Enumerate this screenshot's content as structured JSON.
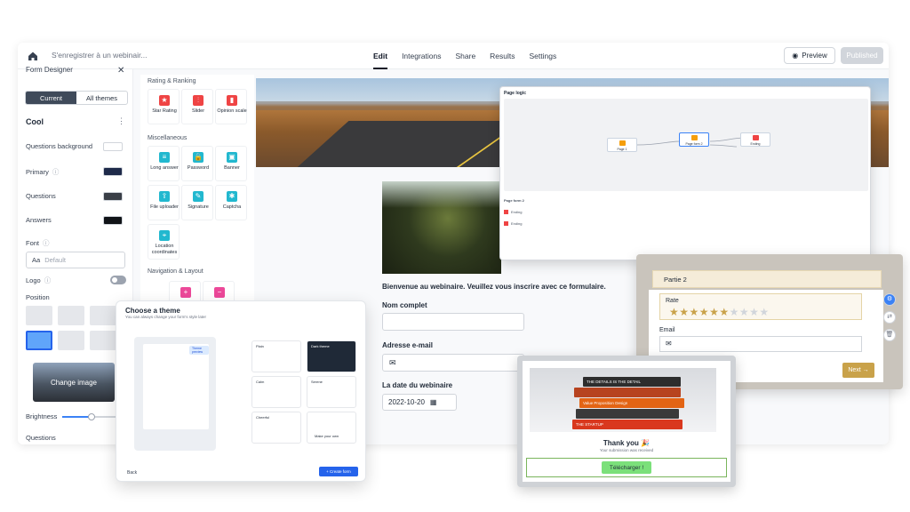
{
  "topbar": {
    "breadcrumb": "S'enregistrer à un webinair...",
    "tabs": [
      "Edit",
      "Integrations",
      "Share",
      "Results",
      "Settings"
    ],
    "active_tab": "Edit",
    "preview_label": "Preview",
    "publish_label": "Published"
  },
  "left_panel": {
    "title": "Form Designer",
    "seg_current": "Current",
    "seg_all": "All themes",
    "theme_name": "Cool",
    "rows": {
      "questions_bg": "Questions background",
      "primary": "Primary",
      "questions": "Questions",
      "answers": "Answers",
      "font": "Font",
      "font_value": "Default",
      "logo": "Logo",
      "position": "Position",
      "change_image": "Change image",
      "brightness": "Brightness",
      "questions_footer": "Questions"
    },
    "colors": {
      "questions_bg": "#ffffff",
      "primary": "#1e2a4a",
      "questions": "#3a3f47",
      "answers": "#111418"
    },
    "brightness_value": 0.55
  },
  "palette": {
    "sections": [
      "Rating & Ranking",
      "Miscellaneous",
      "Navigation & Layout"
    ],
    "items": [
      {
        "label": "Star Rating",
        "color": "#ef4444",
        "icon": "★"
      },
      {
        "label": "Slider",
        "color": "#ef4444",
        "icon": "⫶"
      },
      {
        "label": "Opinion scale",
        "color": "#ef4444",
        "icon": "▮"
      },
      {
        "label": "Long answer",
        "color": "#22b8cf",
        "icon": "≡"
      },
      {
        "label": "Password",
        "color": "#22b8cf",
        "icon": "🔒"
      },
      {
        "label": "Banner",
        "color": "#22b8cf",
        "icon": "▣"
      },
      {
        "label": "File uploader",
        "color": "#22b8cf",
        "icon": "⇪"
      },
      {
        "label": "Signature",
        "color": "#22b8cf",
        "icon": "✎"
      },
      {
        "label": "Captcha",
        "color": "#22b8cf",
        "icon": "✱"
      },
      {
        "label": "Location coordinates",
        "color": "#22b8cf",
        "icon": "⌖"
      }
    ]
  },
  "form": {
    "intro": "Bienvenue au webinaire. Veuillez vous inscrire avec ce formulaire.",
    "name_label": "Nom complet",
    "email_label": "Adresse e-mail",
    "date_label": "La date du webinaire",
    "date_value": "2022-10-20"
  },
  "logic": {
    "title": "Page logic",
    "nodes": [
      "Page 1",
      "Page form 2",
      "Ending"
    ],
    "section": "Page form 2",
    "rows": [
      "Ending",
      "Ending"
    ]
  },
  "choose_theme": {
    "title": "Choose a theme",
    "subtitle": "You can always change your form's style later",
    "preview_badge": "Theme preview",
    "themes": [
      "Plain",
      "Dark theme",
      "Calm",
      "Serene",
      "Cheerful",
      "Make your own"
    ],
    "back": "Back",
    "create": "+ Create form"
  },
  "partie": {
    "title": "Partie 2",
    "rate_label": "Rate",
    "rating": 6,
    "rating_max": 10,
    "email_label": "Email",
    "next_label": "Next →"
  },
  "thanks": {
    "title": "Thank you 🎉",
    "subtitle": "Your submission was received",
    "button": "Télécharger !",
    "books": [
      "THE DETAILS IS THE DETAIL",
      "Value Proposition Design",
      "THE STARTUP"
    ]
  }
}
